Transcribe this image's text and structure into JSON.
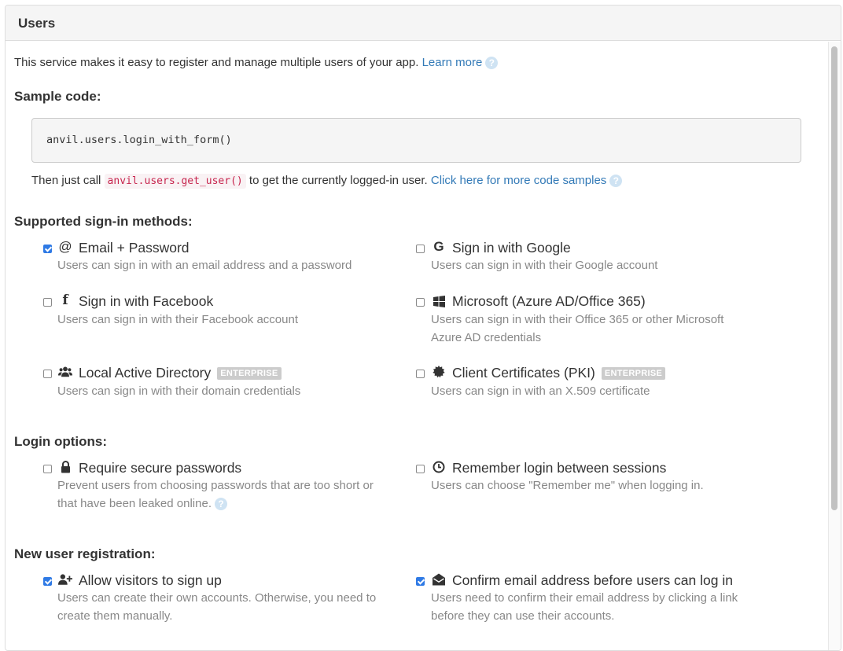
{
  "panel": {
    "title": "Users"
  },
  "intro": {
    "text": "This service makes it easy to register and manage multiple users of your app.",
    "learn_more": "Learn more"
  },
  "sample_code": {
    "heading": "Sample code:",
    "code": "anvil.users.login_with_form()",
    "then_text_before": "Then just call",
    "inline_code": "anvil.users.get_user()",
    "then_text_after": "to get the currently logged-in user.",
    "more_link": "Click here for more code samples"
  },
  "signin": {
    "heading": "Supported sign-in methods:",
    "enterprise_badge": "ENTERPRISE",
    "methods": [
      {
        "title": "Email + Password",
        "desc": "Users can sign in with an email address and a password",
        "checked": true,
        "icon": "at-icon"
      },
      {
        "title": "Sign in with Google",
        "desc": "Users can sign in with their Google account",
        "checked": false,
        "icon": "google-icon"
      },
      {
        "title": "Sign in with Facebook",
        "desc": "Users can sign in with their Facebook account",
        "checked": false,
        "icon": "facebook-icon"
      },
      {
        "title": "Microsoft (Azure AD/Office 365)",
        "desc": "Users can sign in with their Office 365 or other Microsoft Azure AD credentials",
        "checked": false,
        "icon": "windows-icon"
      },
      {
        "title": "Local Active Directory",
        "desc": "Users can sign in with their domain credentials",
        "checked": false,
        "icon": "users-icon",
        "enterprise": true
      },
      {
        "title": "Client Certificates (PKI)",
        "desc": "Users can sign in with an X.509 certificate",
        "checked": false,
        "icon": "certificate-icon",
        "enterprise": true
      }
    ]
  },
  "login_options": {
    "heading": "Login options:",
    "options": [
      {
        "title": "Require secure passwords",
        "desc": "Prevent users from choosing passwords that are too short or that have been leaked online.",
        "checked": false,
        "icon": "lock-icon"
      },
      {
        "title": "Remember login between sessions",
        "desc": "Users can choose \"Remember me\" when logging in.",
        "checked": false,
        "icon": "clock-icon"
      }
    ]
  },
  "registration": {
    "heading": "New user registration:",
    "options": [
      {
        "title": "Allow visitors to sign up",
        "desc": "Users can create their own accounts. Otherwise, you need to create them manually.",
        "checked": true,
        "icon": "user-plus-icon"
      },
      {
        "title": "Confirm email address before users can log in",
        "desc": "Users need to confirm their email address by clicking a link before they can use their accounts.",
        "checked": true,
        "icon": "envelope-open-icon"
      }
    ]
  },
  "colors": {
    "link": "#337ab7",
    "checkbox_on": "#2f7ae5",
    "badge": "#cccccc",
    "desc": "#888888"
  }
}
